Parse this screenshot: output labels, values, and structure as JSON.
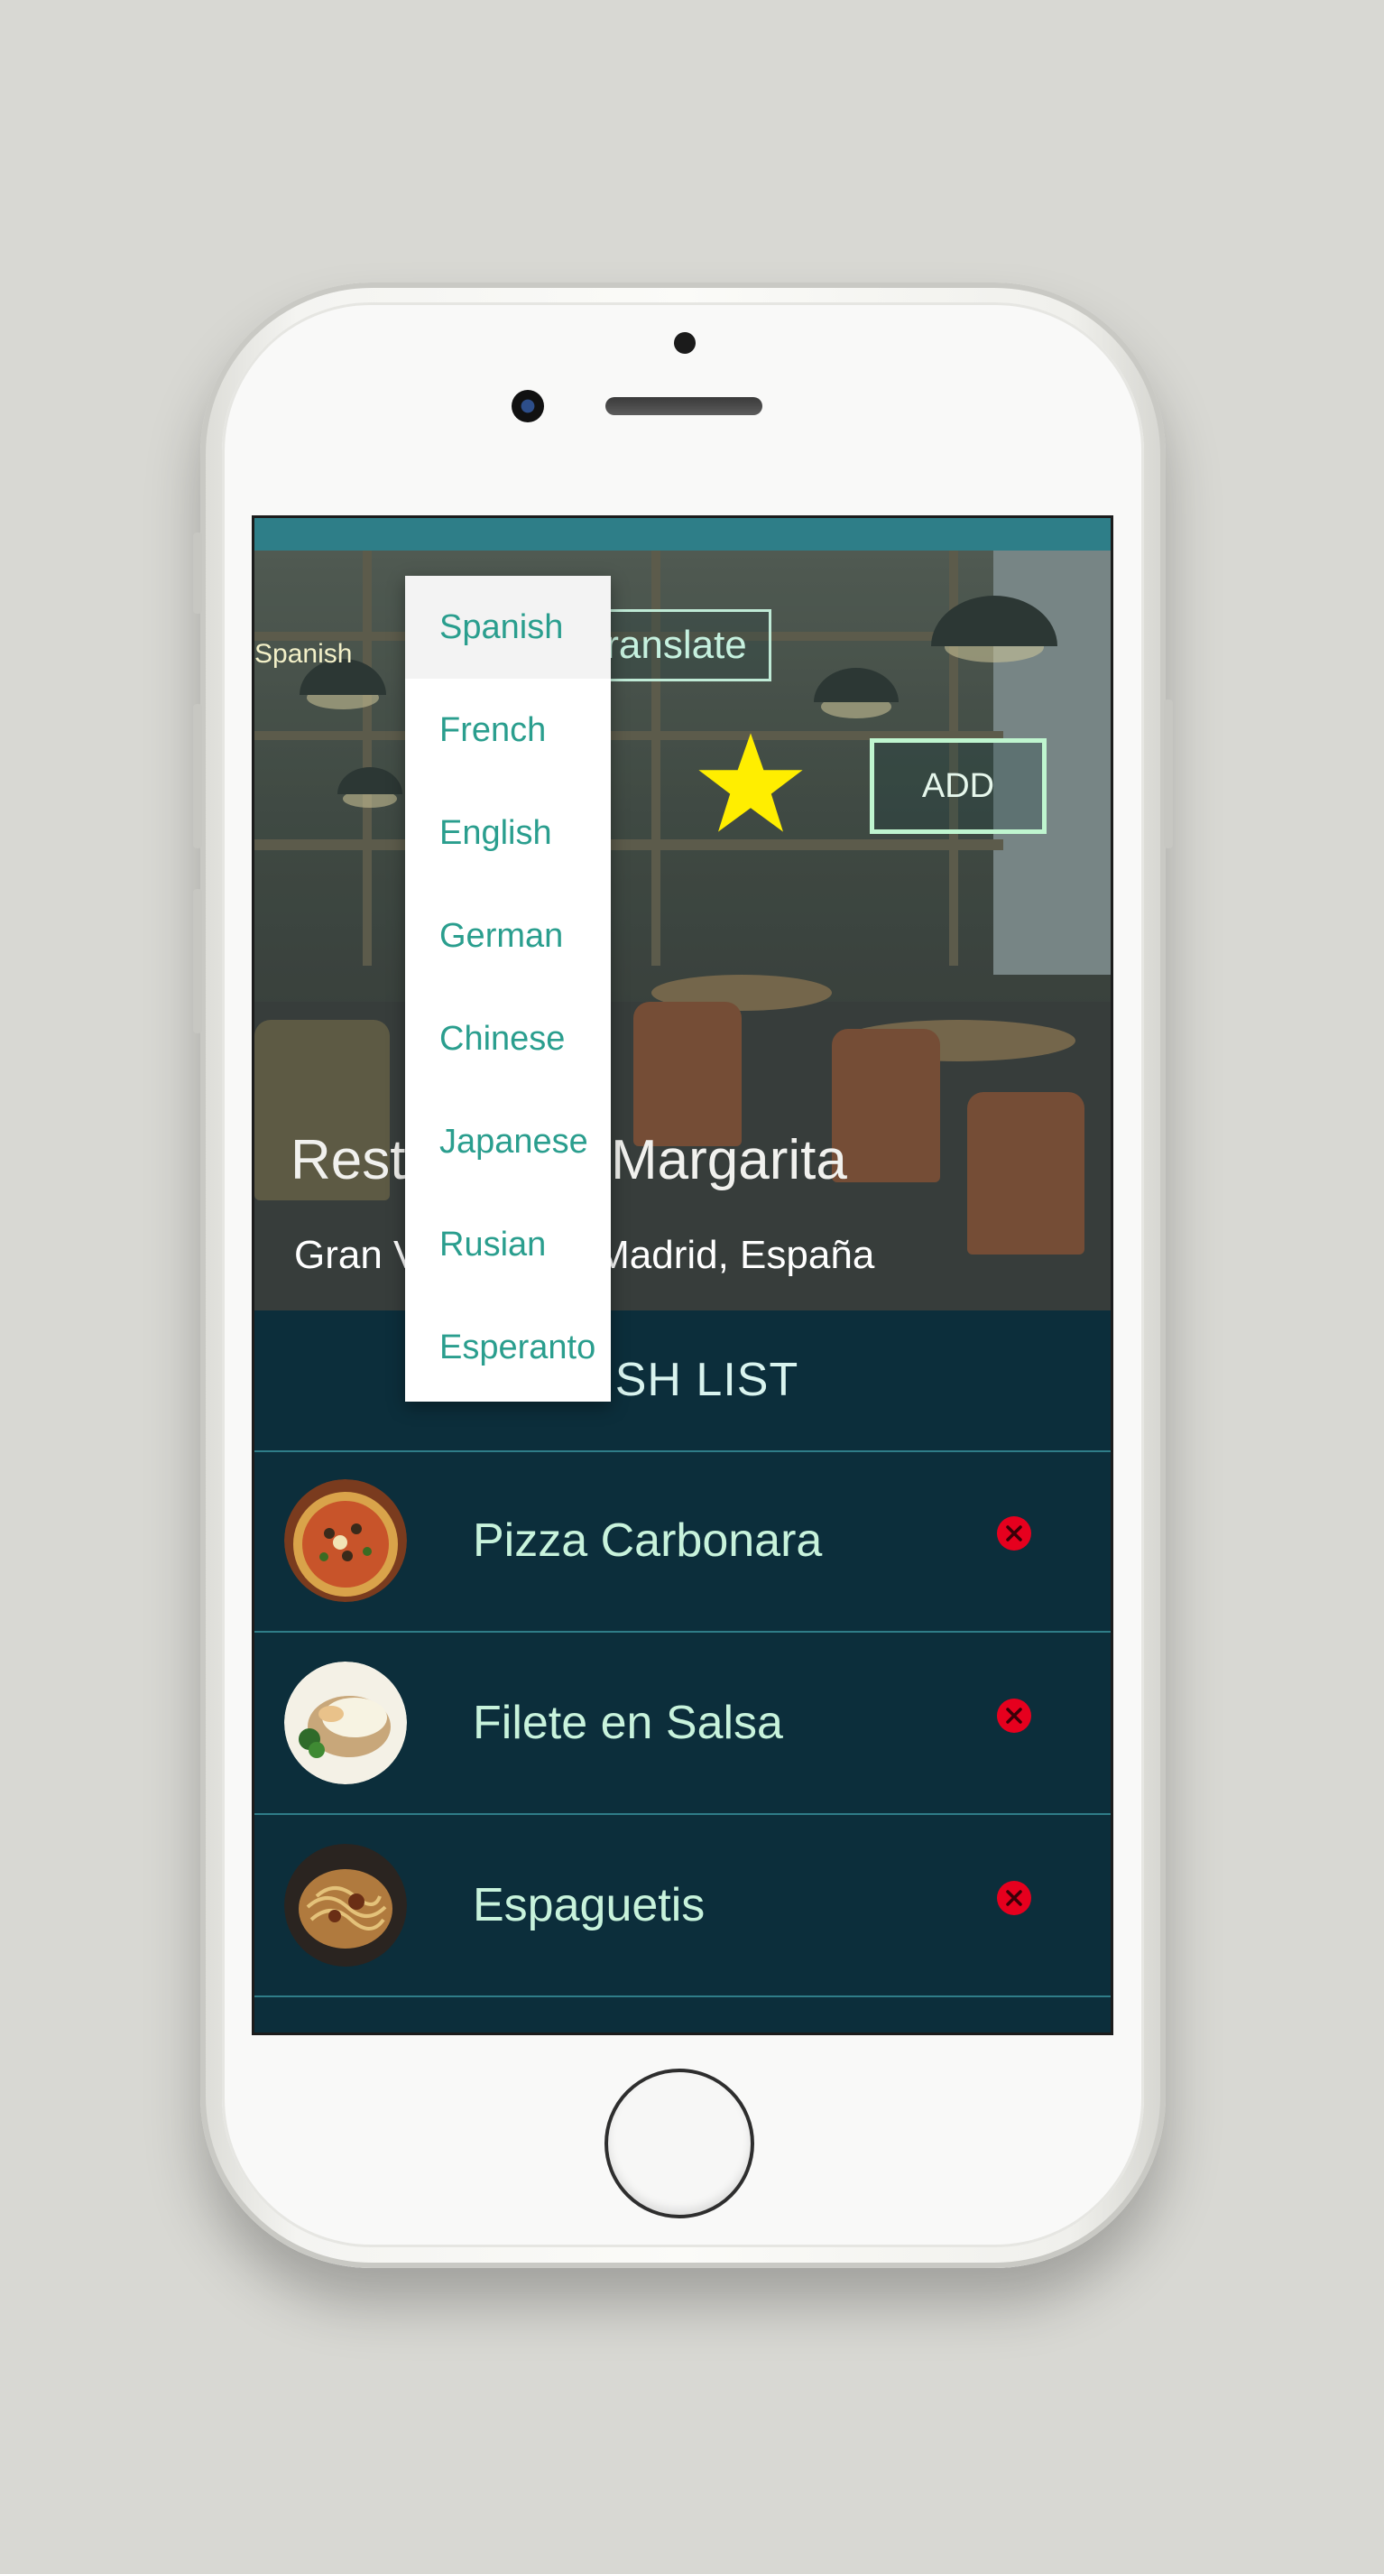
{
  "header": {
    "language_select_value": "Spanish",
    "translate_label": "Translate",
    "add_label": "ADD"
  },
  "restaurant": {
    "name": "Restaurante Margarita",
    "address": "Gran Vía, 28013 Madrid, España"
  },
  "language_dropdown": {
    "options": [
      "Spanish",
      "French",
      "English",
      "German",
      "Chinese",
      "Japanese",
      "Rusian",
      "Esperanto"
    ],
    "selected": "Spanish"
  },
  "dish_list": {
    "title": "DISH LIST",
    "items": [
      {
        "name": "Pizza Carbonara",
        "image": "pizza"
      },
      {
        "name": "Filete en Salsa",
        "image": "steak-with-sauce"
      },
      {
        "name": "Espaguetis",
        "image": "spaghetti"
      }
    ]
  },
  "colors": {
    "accent": "#2a9e8e",
    "list_background": "#0c2e3b",
    "star": "#ffee00",
    "delete": "#e6001e"
  },
  "icons": [
    "star-icon",
    "delete-icon"
  ]
}
